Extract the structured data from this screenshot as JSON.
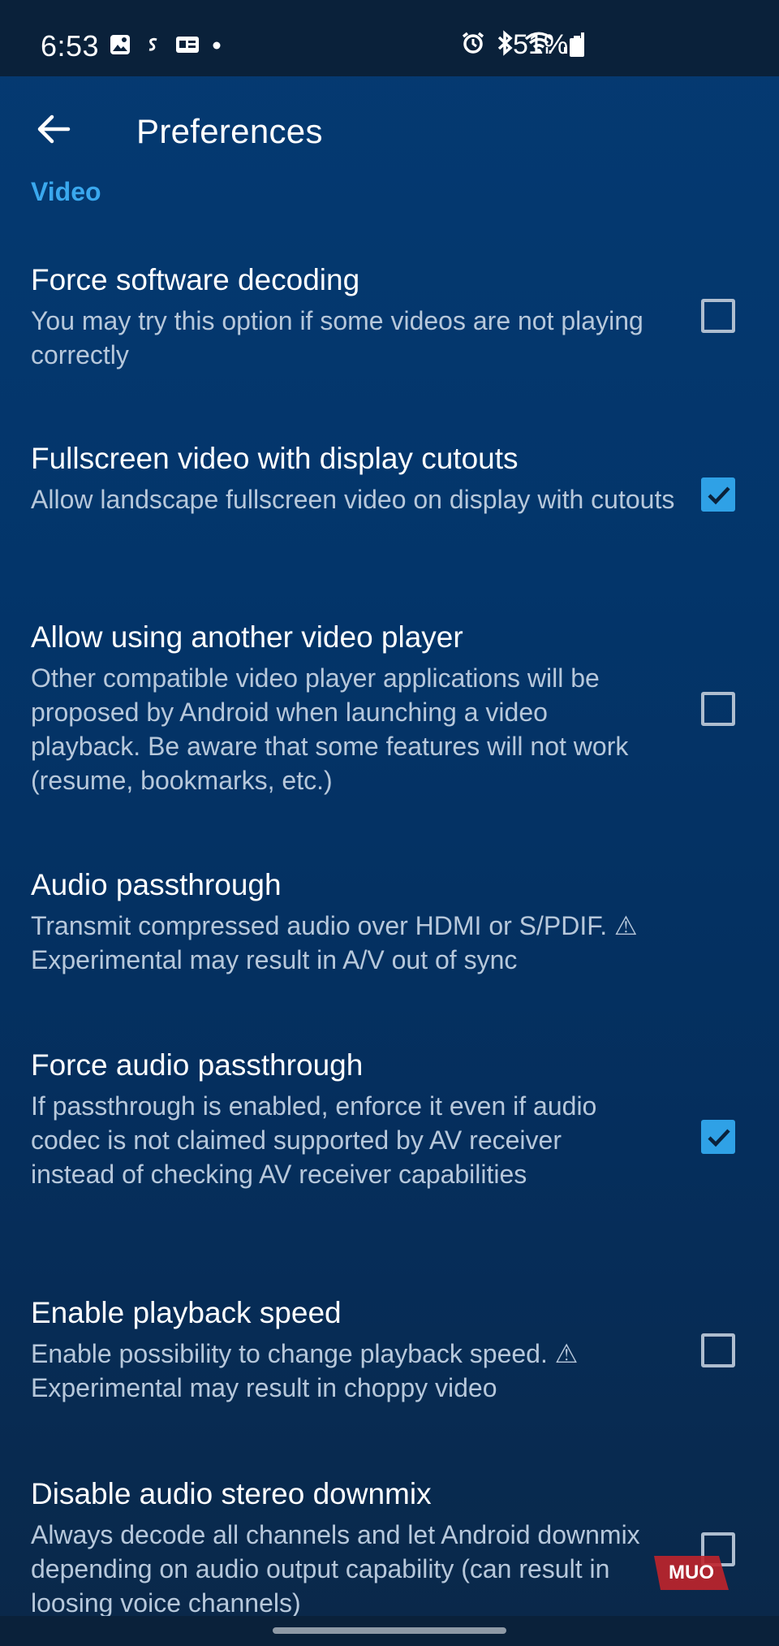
{
  "status_bar": {
    "time": "6:53",
    "battery_percent": "51%",
    "left_icons": [
      "gallery-icon",
      "s-app-icon",
      "news-icon",
      "notification-dot-icon"
    ],
    "right_icons": [
      "alarm-icon",
      "bluetooth-icon",
      "wifi-icon",
      "signal-icon",
      "battery-icon"
    ]
  },
  "app_bar": {
    "title": "Preferences",
    "back_icon": "arrow-left-icon"
  },
  "section": {
    "header": "Video"
  },
  "preferences": [
    {
      "title": "Force software decoding",
      "summary": "You may try this option if some videos are not playing correctly",
      "checked": false
    },
    {
      "title": "Fullscreen video with display cutouts",
      "summary": "Allow landscape fullscreen video on display with cutouts",
      "checked": true
    },
    {
      "title": "Allow using another video player",
      "summary": "Other compatible video player applications will be proposed by Android when launching a video playback. Be aware that some features will not work (resume, bookmarks, etc.)",
      "checked": false
    },
    {
      "title": "Audio passthrough",
      "summary": "Transmit compressed audio over HDMI or S/PDIF. ⚠ Experimental may result in A/V out of sync",
      "checked": null
    },
    {
      "title": "Force audio passthrough",
      "summary": "If passthrough is enabled, enforce it even if audio codec is not claimed supported by AV receiver instead of checking AV receiver capabilities",
      "checked": true
    },
    {
      "title": "Enable playback speed",
      "summary": "Enable possibility to change playback speed. ⚠ Experimental may result in choppy video",
      "checked": false
    },
    {
      "title": "Disable audio stereo downmix",
      "summary": "Always decode all channels and let Android downmix depending on audio output capability (can result in loosing voice channels)",
      "checked": false
    }
  ],
  "watermark": {
    "text": "MUO"
  },
  "colors": {
    "accent": "#3aa8ee",
    "checkbox_checked": "#2fa1e6",
    "background": "#03356a",
    "summary_text": "#b7c8db"
  }
}
